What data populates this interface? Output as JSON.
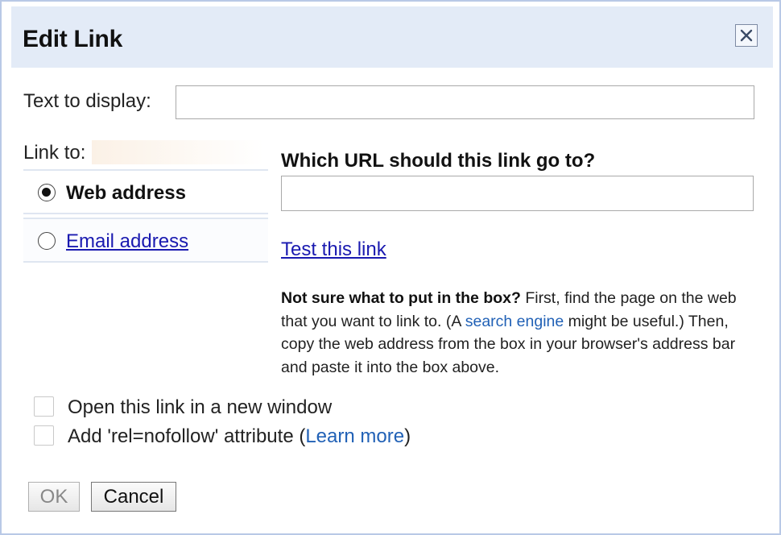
{
  "dialog": {
    "title": "Edit Link",
    "close_icon": "close-icon"
  },
  "display": {
    "label": "Text to display:",
    "value": ""
  },
  "link_to": {
    "label": "Link to:",
    "options": [
      {
        "label": "Web address",
        "selected": true
      },
      {
        "label": "Email address",
        "selected": false
      }
    ]
  },
  "url": {
    "heading": "Which URL should this link go to?",
    "value": "",
    "test_link": "Test this link"
  },
  "help": {
    "bold": "Not sure what to put in the box?",
    "part1": " First, find the page on the web that you want to link to. (A ",
    "link": "search engine",
    "part2": " might be useful.) Then, copy the web address from the box in your browser's address bar and paste it into the box above."
  },
  "options": {
    "new_window": {
      "label": "Open this link in a new window",
      "checked": false
    },
    "nofollow": {
      "label_prefix": "Add 'rel=nofollow' attribute (",
      "link": "Learn more",
      "label_suffix": ")",
      "checked": false
    }
  },
  "buttons": {
    "ok": "OK",
    "cancel": "Cancel"
  },
  "colors": {
    "titlebar": "#e3ebf7",
    "link": "#1a1ab0",
    "help_link": "#2161b6"
  }
}
